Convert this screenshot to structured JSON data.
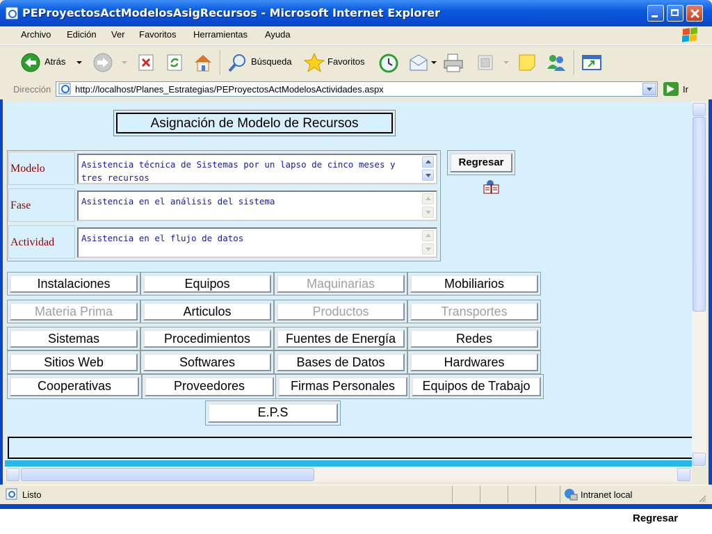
{
  "window": {
    "title": "PEProyectosActModelosAsigRecursos - Microsoft Internet Explorer"
  },
  "menu": {
    "items": [
      "Archivo",
      "Edición",
      "Ver",
      "Favoritos",
      "Herramientas",
      "Ayuda"
    ]
  },
  "toolbar": {
    "back_label": "Atrás",
    "search_label": "Búsqueda",
    "favorites_label": "Favoritos"
  },
  "address": {
    "label": "Dirección",
    "url": "http://localhost/Planes_Estrategias/PEProyectosActModelosActividades.aspx",
    "go_label": "Ir"
  },
  "page": {
    "heading": "Asignación de Modelo de Recursos",
    "regresar_button": "Regresar",
    "fields": [
      {
        "label": "Modelo",
        "value": "Asistencia técnica de Sistemas por un lapso de cinco meses y tres recursos"
      },
      {
        "label": "Fase",
        "value": "Asistencia en el análisis del sistema"
      },
      {
        "label": "Actividad",
        "value": "Asistencia en el flujo de datos"
      }
    ],
    "resource_buttons": [
      {
        "label": "Instalaciones",
        "enabled": true
      },
      {
        "label": "Equipos",
        "enabled": true
      },
      {
        "label": "Maquinarias",
        "enabled": false
      },
      {
        "label": "Mobiliarios",
        "enabled": true
      },
      {
        "label": "Materia Prima",
        "enabled": false
      },
      {
        "label": "Articulos",
        "enabled": true
      },
      {
        "label": "Productos",
        "enabled": false
      },
      {
        "label": "Transportes",
        "enabled": false
      },
      {
        "label": "Sistemas",
        "enabled": true
      },
      {
        "label": "Procedimientos",
        "enabled": true
      },
      {
        "label": "Fuentes de Energía",
        "enabled": true
      },
      {
        "label": "Redes",
        "enabled": true
      },
      {
        "label": "Sitios Web",
        "enabled": true
      },
      {
        "label": "Softwares",
        "enabled": true
      },
      {
        "label": "Bases de Datos",
        "enabled": true
      },
      {
        "label": "Hardwares",
        "enabled": true
      },
      {
        "label": "Cooperativas",
        "enabled": true
      },
      {
        "label": "Proveedores",
        "enabled": true
      },
      {
        "label": "Firmas Personales",
        "enabled": true
      },
      {
        "label": "Equipos de Trabajo",
        "enabled": true
      }
    ],
    "eps_button": "E.P.S"
  },
  "status": {
    "text": "Listo",
    "zone": "Intranet local"
  },
  "footer": {
    "regresar": "Regresar"
  },
  "colors": {
    "content_bg": "#d8f0fc",
    "field_label": "#8b0000",
    "field_text": "#1a1aa0",
    "disabled_text": "#a0a0a0"
  }
}
